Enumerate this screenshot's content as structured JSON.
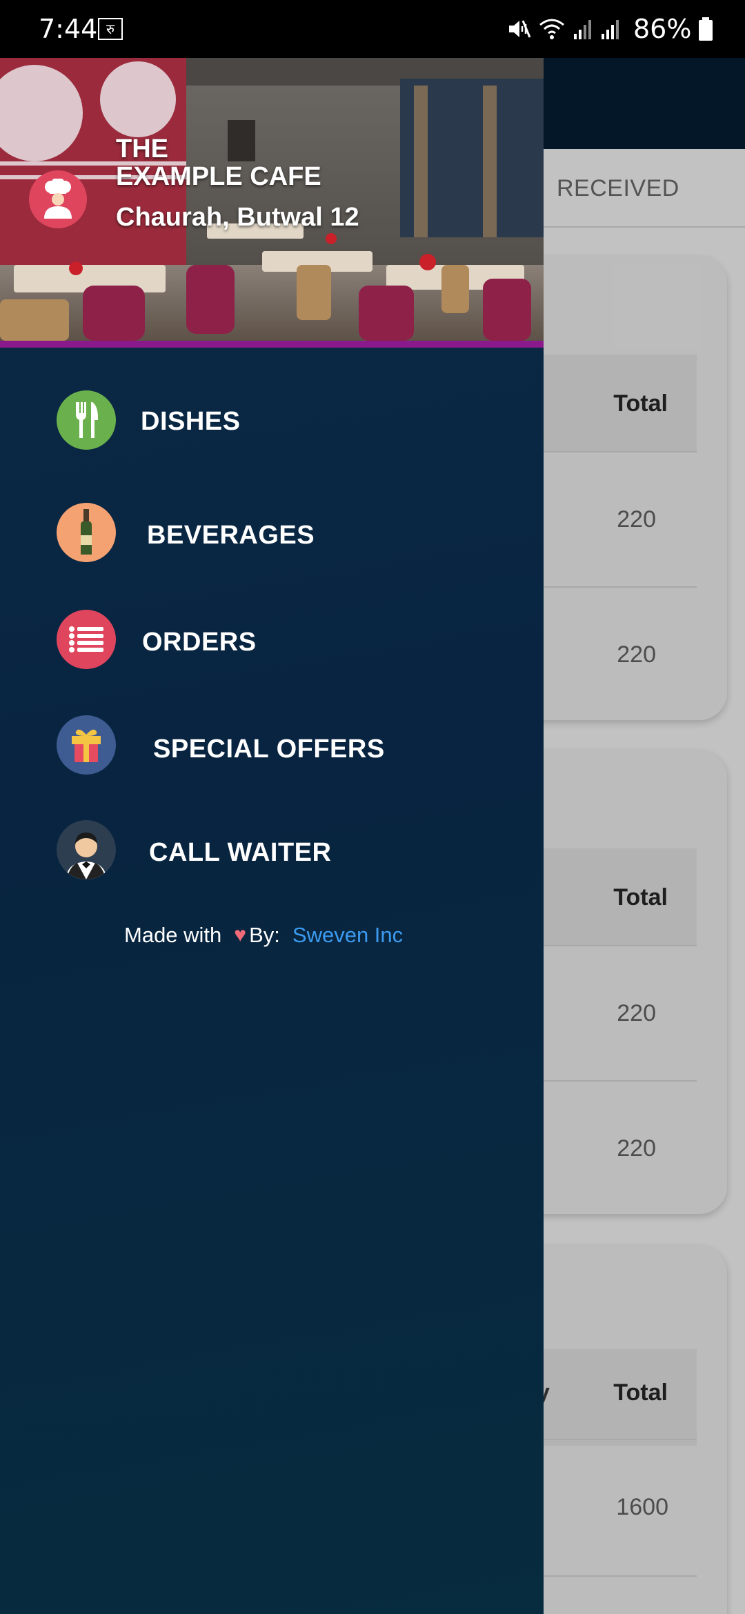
{
  "status_bar": {
    "time": "7:44",
    "notification_badge": "रु",
    "battery": "86%"
  },
  "background_screen": {
    "tab_label": "RECEIVED",
    "cards": [
      {
        "headers": [
          "Total"
        ],
        "values": [
          "220",
          "220"
        ]
      },
      {
        "headers": [
          "Total"
        ],
        "values": [
          "220",
          "220"
        ]
      },
      {
        "headers": [
          "y",
          "Total"
        ],
        "values": [
          "1600"
        ]
      }
    ]
  },
  "drawer": {
    "cafe_name_line1": "THE",
    "cafe_name_line2": "EXAMPLE CAFE",
    "address": "Chaurah, Butwal 12",
    "accent_color": "#8a1a8c",
    "menu": [
      {
        "label": "DISHES",
        "icon": "fork-knife-icon",
        "color": "#6ab04c"
      },
      {
        "label": "BEVERAGES",
        "icon": "wine-bottle-icon",
        "color": "#f4a271"
      },
      {
        "label": "ORDERS",
        "icon": "list-icon",
        "color": "#e0455e"
      },
      {
        "label": "SPECIAL OFFERS",
        "icon": "gift-icon",
        "color": "#3e5b92"
      },
      {
        "label": "CALL WAITER",
        "icon": "waiter-icon",
        "color": "#2c3e50"
      }
    ],
    "footer": {
      "made_with": "Made with",
      "by": "By:",
      "company": "Sweven Inc"
    }
  }
}
